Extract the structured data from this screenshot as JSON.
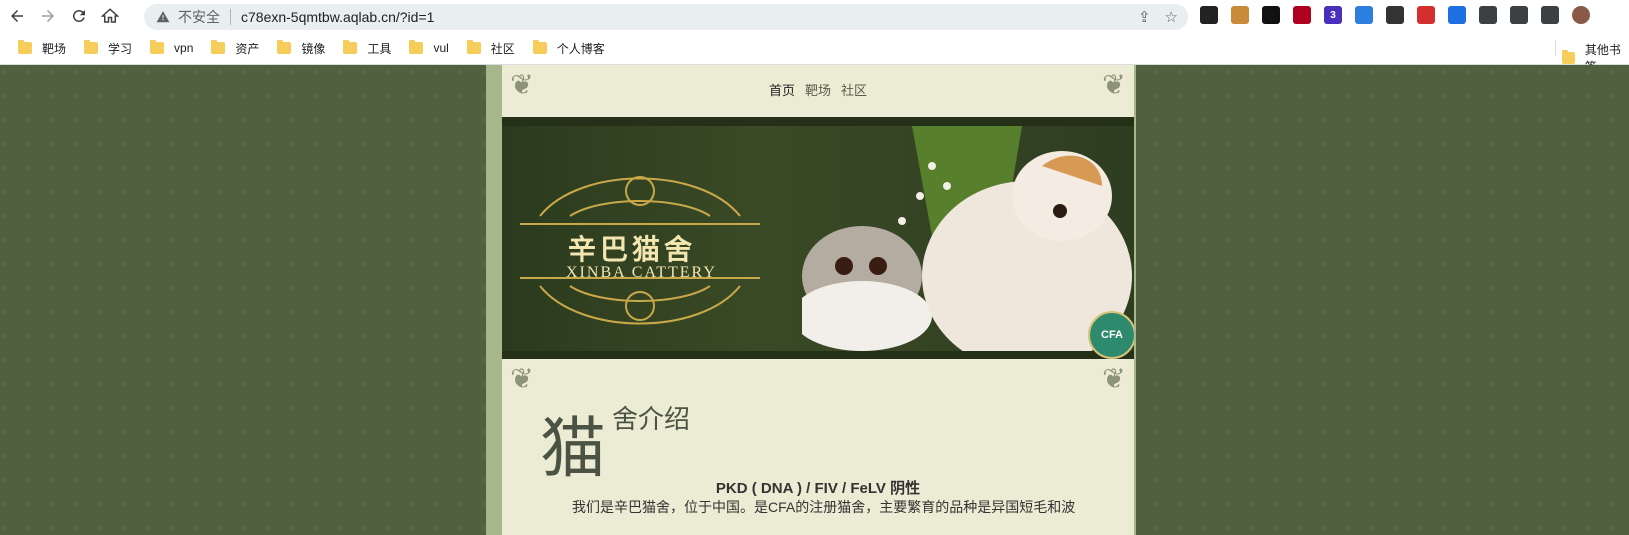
{
  "browser": {
    "url": "c78exn-5qmtbw.aqlab.cn/?id=1",
    "security_label": "不安全",
    "bookmarks": [
      "靶场",
      "学习",
      "vpn",
      "资产",
      "镜像",
      "工具",
      "vul",
      "社区",
      "个人博客"
    ],
    "other_bookmarks": "其他书签",
    "extensions": [
      {
        "icon": "hat-icon",
        "color": "#222222"
      },
      {
        "icon": "cookie-icon",
        "color": "#c98a3a"
      },
      {
        "icon": "ring-icon",
        "color": "#111111"
      },
      {
        "icon": "glasses-icon",
        "color": "#b00020"
      },
      {
        "icon": "cube-icon",
        "color": "#4a2fbd",
        "badge": "3"
      },
      {
        "icon": "eye-icon",
        "color": "#2d7fe0"
      },
      {
        "icon": "panda-icon",
        "color": "#333333"
      },
      {
        "icon": "x-icon",
        "color": "#d32f2f"
      },
      {
        "icon": "hex-icon",
        "color": "#1e6fe0"
      },
      {
        "icon": "puzzle-icon",
        "color": "#3c4043"
      },
      {
        "icon": "list-icon",
        "color": "#3c4043"
      },
      {
        "icon": "sidepanel-icon",
        "color": "#3c4043"
      },
      {
        "icon": "profile-avatar",
        "color": "#8a5a48"
      }
    ]
  },
  "site": {
    "nav": [
      "首页",
      "靶场",
      "社区"
    ],
    "active_nav": "首页",
    "banner_title_cn": "辛巴猫舍",
    "banner_title_en": "XINBA CATTERY",
    "badge_text": "CFA",
    "heading_big": "猫",
    "heading_rest": "舍介绍",
    "test_line": "PKD ( DNA ) / FIV / FeLV 阴性",
    "intro": "我们是辛巴猫舍，位于中国。是CFA的注册猫舍，主要繁育的品种是异国短毛和波"
  },
  "colors": {
    "page_bg": "#50613f",
    "frame": "#a6b78c",
    "content_bg": "#ecebd3",
    "banner_dark": "#253018",
    "gold": "#f4e6b0"
  }
}
